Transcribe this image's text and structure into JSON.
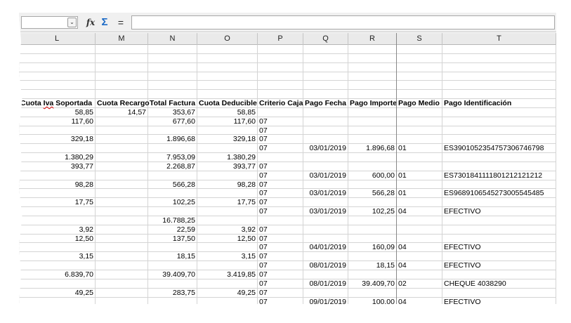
{
  "toolbar": {
    "name_box_value": "",
    "name_box_arrow": "⌄",
    "fx_label": "fx",
    "sum_label": "Σ",
    "equals_label": "=",
    "formula_value": ""
  },
  "columns": [
    "L",
    "M",
    "N",
    "O",
    "P",
    "Q",
    "R",
    "S",
    "T"
  ],
  "header_row": {
    "cuota_iva_prefix": "Cuota ",
    "cuota_iva_spell": "Iva",
    "cuota_iva_suffix": " Soportada",
    "cuota_recargo": "Cuota Recargo",
    "total_factura": "Total Factura",
    "cuota_deducible": "Cuota Deducible",
    "criterio_caja": "Criterio Caja",
    "pago_fecha": "Pago Fecha",
    "pago_importe": "Pago Importe",
    "pago_medio": "Pago Medio",
    "pago_identificacion": "Pago Identificación"
  },
  "rows": [
    [
      "58,85",
      "14,57",
      "353,67",
      "58,85",
      "",
      "",
      "",
      "",
      ""
    ],
    [
      "117,60",
      "",
      "677,60",
      "117,60",
      "07",
      "",
      "",
      "",
      ""
    ],
    [
      "",
      "",
      "",
      "",
      "07",
      "",
      "",
      "",
      ""
    ],
    [
      "329,18",
      "",
      "1.896,68",
      "329,18",
      "07",
      "",
      "",
      "",
      ""
    ],
    [
      "",
      "",
      "",
      "",
      "07",
      "03/01/2019",
      "1.896,68",
      "01",
      "ES3901052354757306746798"
    ],
    [
      "1.380,29",
      "",
      "7.953,09",
      "1.380,29",
      "",
      "",
      "",
      "",
      ""
    ],
    [
      "393,77",
      "",
      "2.268,87",
      "393,77",
      "07",
      "",
      "",
      "",
      ""
    ],
    [
      "",
      "",
      "",
      "",
      "07",
      "03/01/2019",
      "600,00",
      "01",
      "ES7301841111801212121212"
    ],
    [
      "98,28",
      "",
      "566,28",
      "98,28",
      "07",
      "",
      "",
      "",
      ""
    ],
    [
      "",
      "",
      "",
      "",
      "07",
      "03/01/2019",
      "566,28",
      "01",
      "ES9689106545273005545485"
    ],
    [
      "17,75",
      "",
      "102,25",
      "17,75",
      "07",
      "",
      "",
      "",
      ""
    ],
    [
      "",
      "",
      "",
      "",
      "07",
      "03/01/2019",
      "102,25",
      "04",
      "EFECTIVO"
    ],
    [
      "",
      "",
      "16.788,25",
      "",
      "",
      "",
      "",
      "",
      ""
    ],
    [
      "3,92",
      "",
      "22,59",
      "3,92",
      "07",
      "",
      "",
      "",
      ""
    ],
    [
      "12,50",
      "",
      "137,50",
      "12,50",
      "07",
      "",
      "",
      "",
      ""
    ],
    [
      "",
      "",
      "",
      "",
      "07",
      "04/01/2019",
      "160,09",
      "04",
      "EFECTIVO"
    ],
    [
      "3,15",
      "",
      "18,15",
      "3,15",
      "07",
      "",
      "",
      "",
      ""
    ],
    [
      "",
      "",
      "",
      "",
      "07",
      "08/01/2019",
      "18,15",
      "04",
      "EFECTIVO"
    ],
    [
      "6.839,70",
      "",
      "39.409,70",
      "3.419,85",
      "07",
      "",
      "",
      "",
      ""
    ],
    [
      "",
      "",
      "",
      "",
      "07",
      "08/01/2019",
      "39.409,70",
      "02",
      "CHEQUE 4038290"
    ],
    [
      "49,25",
      "",
      "283,75",
      "49,25",
      "07",
      "",
      "",
      "",
      ""
    ],
    [
      "",
      "",
      "",
      "",
      "07",
      "09/01/2019",
      "100,00",
      "04",
      "EFECTIVO"
    ]
  ]
}
